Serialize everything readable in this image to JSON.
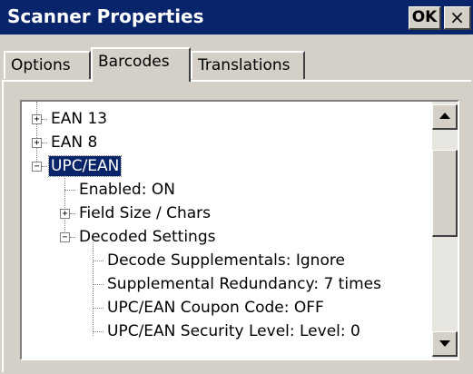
{
  "window": {
    "title": "Scanner Properties",
    "ok_label": "OK",
    "close_label": "×"
  },
  "tabs": [
    {
      "label": "Options",
      "active": false
    },
    {
      "label": "Barcodes",
      "active": true
    },
    {
      "label": "Translations",
      "active": false
    }
  ],
  "tree": {
    "items": [
      {
        "label": "EAN 13",
        "level": 0,
        "expander": "+"
      },
      {
        "label": "EAN 8",
        "level": 0,
        "expander": "+"
      },
      {
        "label": "UPC/EAN",
        "level": 0,
        "expander": "-",
        "selected": true
      },
      {
        "label": "Enabled: ON",
        "level": 1
      },
      {
        "label": "Field Size / Chars",
        "level": 1,
        "expander": "+"
      },
      {
        "label": "Decoded Settings",
        "level": 1,
        "expander": "-"
      },
      {
        "label": "Decode Supplementals: Ignore",
        "level": 2
      },
      {
        "label": "Supplemental Redundancy: 7 times",
        "level": 2
      },
      {
        "label": "UPC/EAN Coupon Code: OFF",
        "level": 2
      },
      {
        "label": "UPC/EAN Security Level: Level: 0",
        "level": 2
      }
    ]
  },
  "colors": {
    "titlebar": "#08246b",
    "face": "#d4d0c8",
    "selection": "#0a246a"
  },
  "icons": [
    "close-icon",
    "scroll-up-arrow-icon",
    "scroll-down-arrow-icon",
    "expand-plus-icon",
    "collapse-minus-icon"
  ]
}
